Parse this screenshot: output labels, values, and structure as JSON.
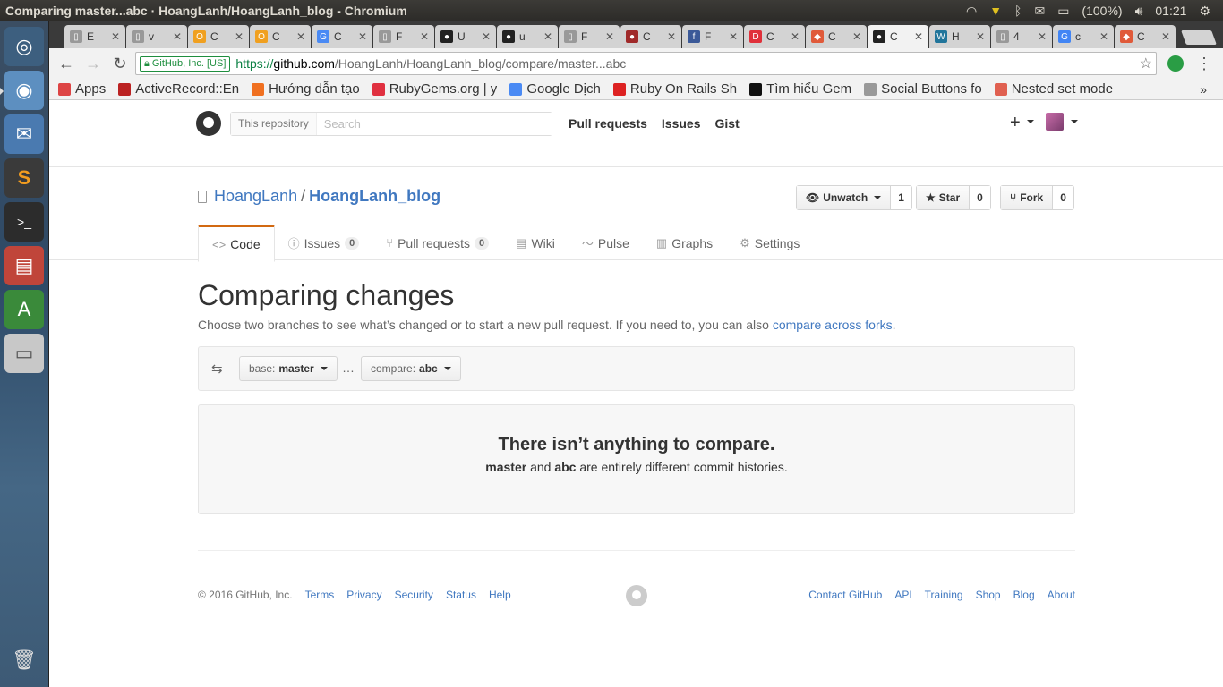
{
  "panel": {
    "window_title": "Comparing master...abc · HoangLanh/HoangLanh_blog - Chromium",
    "battery": "(100%)",
    "clock": "01:21"
  },
  "tabs": [
    {
      "label": "E",
      "fav_color": "#999",
      "fav_char": "▯"
    },
    {
      "label": "v",
      "fav_color": "#999",
      "fav_char": "▯"
    },
    {
      "label": "C",
      "fav_color": "#f0a020",
      "fav_char": "O"
    },
    {
      "label": "C",
      "fav_color": "#f0a020",
      "fav_char": "O"
    },
    {
      "label": "C",
      "fav_color": "#4a8af4",
      "fav_char": "G"
    },
    {
      "label": "F",
      "fav_color": "#999",
      "fav_char": "▯"
    },
    {
      "label": "U",
      "fav_color": "#222",
      "fav_char": "●"
    },
    {
      "label": "u",
      "fav_color": "#222",
      "fav_char": "●"
    },
    {
      "label": "F",
      "fav_color": "#999",
      "fav_char": "▯"
    },
    {
      "label": "C",
      "fav_color": "#a02a2a",
      "fav_char": "●"
    },
    {
      "label": "F",
      "fav_color": "#3b5998",
      "fav_char": "f"
    },
    {
      "label": "C",
      "fav_color": "#e0303a",
      "fav_char": "D"
    },
    {
      "label": "C",
      "fav_color": "#e05a3a",
      "fav_char": "◆"
    },
    {
      "label": "C",
      "fav_color": "#222",
      "fav_char": "●",
      "active": true
    },
    {
      "label": "H",
      "fav_color": "#21759b",
      "fav_char": "W"
    },
    {
      "label": "4",
      "fav_color": "#999",
      "fav_char": "▯"
    },
    {
      "label": "c",
      "fav_color": "#4285f4",
      "fav_char": "G"
    },
    {
      "label": "C",
      "fav_color": "#e05a3a",
      "fav_char": "◆"
    }
  ],
  "toolbar": {
    "ev_label": "GitHub, Inc. [US]",
    "url_scheme": "https://",
    "url_host": "github.com",
    "url_path": "/HoangLanh/HoangLanh_blog/compare/master...abc"
  },
  "bookmarks": [
    {
      "label": "Apps",
      "color": "#d44"
    },
    {
      "label": "ActiveRecord::En",
      "color": "#b22"
    },
    {
      "label": "Hướng dẫn tạo",
      "color": "#f07020"
    },
    {
      "label": "RubyGems.org | y",
      "color": "#e03040"
    },
    {
      "label": "Google Dịch",
      "color": "#4a8af4"
    },
    {
      "label": "Ruby On Rails Sh",
      "color": "#d22"
    },
    {
      "label": "Tìm hiểu Gem",
      "color": "#111"
    },
    {
      "label": "Social Buttons fo",
      "color": "#999"
    },
    {
      "label": "Nested set mode",
      "color": "#e06050"
    }
  ],
  "bookmarks_more": "»",
  "gh_header": {
    "search_scope": "This repository",
    "search_placeholder": "Search",
    "nav": [
      "Pull requests",
      "Issues",
      "Gist"
    ],
    "plus": "+"
  },
  "repo": {
    "owner": "HoangLanh",
    "sep": "/",
    "name": "HoangLanh_blog",
    "watch_label": "Unwatch",
    "watch_count": "1",
    "star_label": "Star",
    "star_count": "0",
    "fork_label": "Fork",
    "fork_count": "0"
  },
  "repo_tabs": [
    {
      "label": "Code",
      "icon": "<>",
      "selected": true
    },
    {
      "label": "Issues",
      "icon": "ⓘ",
      "count": "0"
    },
    {
      "label": "Pull requests",
      "icon": "⑂",
      "count": "0"
    },
    {
      "label": "Wiki",
      "icon": "▤"
    },
    {
      "label": "Pulse",
      "icon": "〜"
    },
    {
      "label": "Graphs",
      "icon": "▥"
    },
    {
      "label": "Settings",
      "icon": "⚙"
    }
  ],
  "compare": {
    "title": "Comparing changes",
    "desc": "Choose two branches to see what’s changed or to start a new pull request. If you need to, you can also ",
    "desc_link": "compare across forks",
    "desc_end": ".",
    "base_label": "base:",
    "base_value": "master",
    "dots": "…",
    "compare_label": "compare:",
    "compare_value": "abc",
    "blank_title": "There isn’t anything to compare.",
    "blank_branch1": "master",
    "blank_and": " and ",
    "blank_branch2": "abc",
    "blank_rest": " are entirely different commit histories."
  },
  "footer": {
    "copyright": "© 2016 GitHub, Inc.",
    "left_links": [
      "Terms",
      "Privacy",
      "Security",
      "Status",
      "Help"
    ],
    "right_links": [
      "Contact GitHub",
      "API",
      "Training",
      "Shop",
      "Blog",
      "About"
    ]
  }
}
